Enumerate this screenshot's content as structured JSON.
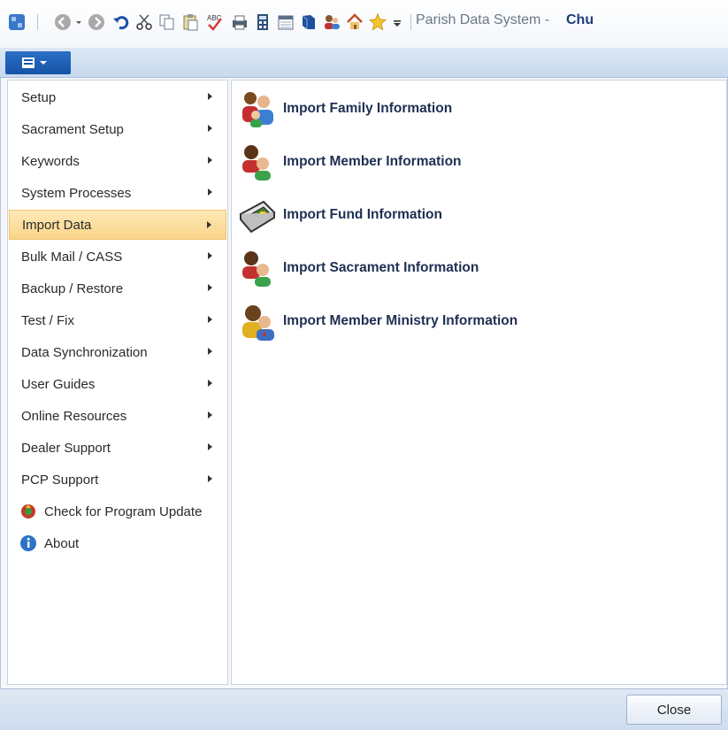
{
  "window": {
    "title": "Parish Data System -",
    "title_suffix": "Chu"
  },
  "toolbar": {
    "icons": [
      "app-icon",
      "back-icon",
      "forward-icon",
      "undo-icon",
      "cut-icon",
      "copy-icon",
      "paste-icon",
      "spellcheck-icon",
      "print-icon",
      "calculator-icon",
      "calendar-icon",
      "book-icon",
      "people-icon",
      "home-icon",
      "star-icon",
      "customize-icon"
    ]
  },
  "menu": {
    "items": [
      {
        "label": "Setup",
        "has_submenu": true
      },
      {
        "label": "Sacrament Setup",
        "has_submenu": true
      },
      {
        "label": "Keywords",
        "has_submenu": true
      },
      {
        "label": "System Processes",
        "has_submenu": true
      },
      {
        "label": "Import Data",
        "has_submenu": true,
        "selected": true
      },
      {
        "label": "Bulk Mail / CASS",
        "has_submenu": true
      },
      {
        "label": "Backup / Restore",
        "has_submenu": true
      },
      {
        "label": "Test / Fix",
        "has_submenu": true
      },
      {
        "label": "Data Synchronization",
        "has_submenu": true
      },
      {
        "label": "User Guides",
        "has_submenu": true
      },
      {
        "label": "Online Resources",
        "has_submenu": true
      },
      {
        "label": "Dealer Support",
        "has_submenu": true
      },
      {
        "label": "PCP Support",
        "has_submenu": true
      },
      {
        "label": "Check for Program Update",
        "icon": "update-icon"
      },
      {
        "label": "About",
        "icon": "info-icon"
      }
    ]
  },
  "submenu": {
    "items": [
      {
        "label": "Import Family Information",
        "icon": "family-icon"
      },
      {
        "label": "Import Member Information",
        "icon": "member-icon"
      },
      {
        "label": "Import Fund Information",
        "icon": "fund-icon"
      },
      {
        "label": "Import Sacrament Information",
        "icon": "sacrament-icon"
      },
      {
        "label": "Import Member Ministry Information",
        "icon": "ministry-icon"
      }
    ]
  },
  "footer": {
    "close_label": "Close"
  },
  "colors": {
    "selected_bg": "#fad58a",
    "ribbon": "#c8d9ee",
    "app_button": "#1653a8"
  }
}
